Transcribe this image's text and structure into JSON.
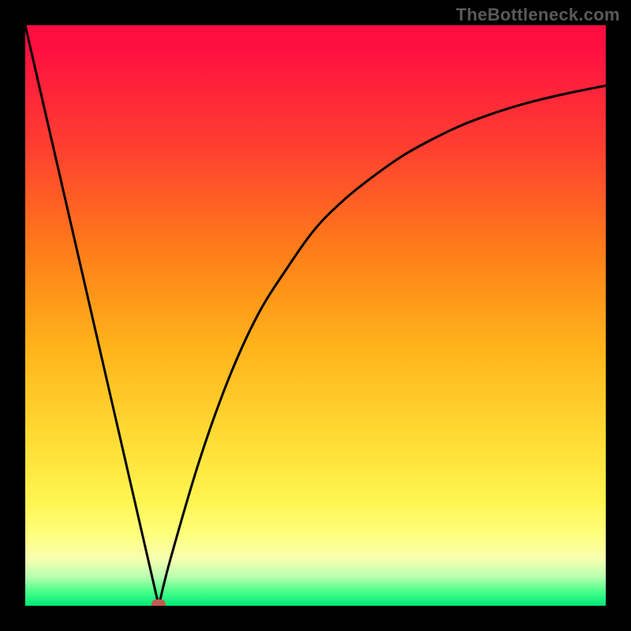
{
  "attribution": "TheBottleneck.com",
  "chart_data": {
    "type": "line",
    "title": "",
    "xlabel": "",
    "ylabel": "",
    "xlim": [
      0,
      100
    ],
    "ylim": [
      0,
      100
    ],
    "grid": false,
    "legend": false,
    "series": [
      {
        "name": "bottleneck-curve",
        "x_min_percent": 23,
        "descent": {
          "x": [
            0,
            5,
            10,
            15,
            20,
            23
          ],
          "y": [
            100,
            78,
            56,
            35,
            13,
            0
          ]
        },
        "ascent": {
          "x": [
            23,
            25,
            30,
            35,
            40,
            45,
            50,
            55,
            60,
            65,
            70,
            75,
            80,
            85,
            90,
            95,
            100
          ],
          "y": [
            0,
            8,
            25,
            39,
            50,
            58,
            65,
            70,
            74,
            77.5,
            80.3,
            82.7,
            84.6,
            86.2,
            87.5,
            88.6,
            89.6
          ]
        }
      }
    ],
    "marker": {
      "x_percent": 23,
      "y_percent": 0,
      "color": "#c5584f"
    },
    "gradient_stops": [
      {
        "pct": 0,
        "color": "#ff0d3f"
      },
      {
        "pct": 21,
        "color": "#ff3f30"
      },
      {
        "pct": 38,
        "color": "#ff7a1a"
      },
      {
        "pct": 55,
        "color": "#ffb21a"
      },
      {
        "pct": 70,
        "color": "#ffd931"
      },
      {
        "pct": 82,
        "color": "#fff550"
      },
      {
        "pct": 92,
        "color": "#f6ffb0"
      },
      {
        "pct": 97,
        "color": "#4cff8a"
      },
      {
        "pct": 100,
        "color": "#00e876"
      }
    ]
  }
}
